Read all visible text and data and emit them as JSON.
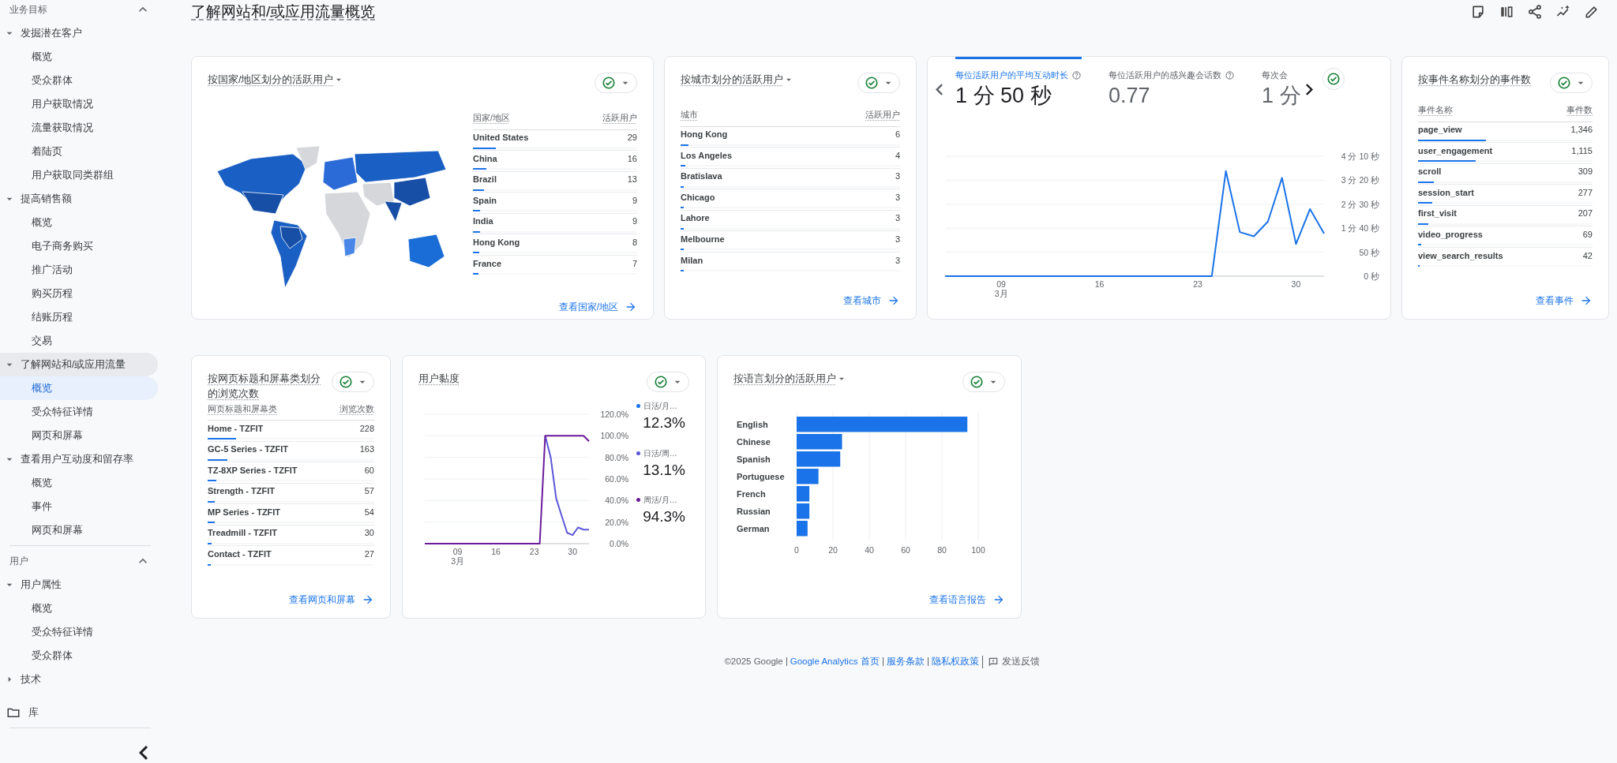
{
  "sidebar": {
    "sections": [
      {
        "label": "业务目标",
        "expanded": true,
        "groups": [
          {
            "label": "发掘潜在客户",
            "expanded": true,
            "selected": false,
            "children": [
              {
                "label": "概览",
                "selected": false
              },
              {
                "label": "受众群体",
                "selected": false
              },
              {
                "label": "用户获取情况",
                "selected": false
              },
              {
                "label": "流量获取情况",
                "selected": false
              },
              {
                "label": "着陆页",
                "selected": false
              },
              {
                "label": "用户获取同类群组",
                "selected": false
              }
            ]
          },
          {
            "label": "提高销售额",
            "expanded": true,
            "selected": false,
            "children": [
              {
                "label": "概览",
                "selected": false
              },
              {
                "label": "电子商务购买",
                "selected": false
              },
              {
                "label": "推广活动",
                "selected": false
              },
              {
                "label": "购买历程",
                "selected": false
              },
              {
                "label": "结账历程",
                "selected": false
              },
              {
                "label": "交易",
                "selected": false
              }
            ]
          },
          {
            "label": "了解网站和/或应用流量",
            "expanded": true,
            "selected": true,
            "children": [
              {
                "label": "概览",
                "selected": true
              },
              {
                "label": "受众特征详情",
                "selected": false
              },
              {
                "label": "网页和屏幕",
                "selected": false
              }
            ]
          },
          {
            "label": "查看用户互动度和留存率",
            "expanded": true,
            "selected": false,
            "children": [
              {
                "label": "概览",
                "selected": false
              },
              {
                "label": "事件",
                "selected": false
              },
              {
                "label": "网页和屏幕",
                "selected": false
              }
            ]
          }
        ]
      },
      {
        "label": "用户",
        "expanded": true,
        "groups": [
          {
            "label": "用户属性",
            "expanded": true,
            "selected": false,
            "children": [
              {
                "label": "概览",
                "selected": false
              },
              {
                "label": "受众特征详情",
                "selected": false
              },
              {
                "label": "受众群体",
                "selected": false
              }
            ]
          },
          {
            "label": "技术",
            "expanded": false,
            "selected": false
          }
        ]
      }
    ],
    "library": "库"
  },
  "page_title": "了解网站和/或应用流量概览",
  "country_card": {
    "title": "按国家/地区划分的活跃用户",
    "has_dropdown": true,
    "columns": [
      "国家/地区",
      "活跃用户"
    ],
    "rows": [
      {
        "label": "United States",
        "value": "29",
        "level": 0.14
      },
      {
        "label": "China",
        "value": "16",
        "level": 0.08
      },
      {
        "label": "Brazil",
        "value": "13",
        "level": 0.065
      },
      {
        "label": "Spain",
        "value": "9",
        "level": 0.045
      },
      {
        "label": "India",
        "value": "9",
        "level": 0.045
      },
      {
        "label": "Hong Kong",
        "value": "8",
        "level": 0.04
      },
      {
        "label": "France",
        "value": "7",
        "level": 0.035
      }
    ],
    "link": "查看国家/地区"
  },
  "city_card": {
    "title": "按城市划分的活跃用户",
    "has_dropdown": true,
    "columns": [
      "城市",
      "活跃用户"
    ],
    "rows": [
      {
        "label": "Hong Kong",
        "value": "6",
        "level": 0.036
      },
      {
        "label": "Los Angeles",
        "value": "4",
        "level": 0.022
      },
      {
        "label": "Bratislava",
        "value": "3",
        "level": 0.016
      },
      {
        "label": "Chicago",
        "value": "3",
        "level": 0.016
      },
      {
        "label": "Lahore",
        "value": "3",
        "level": 0.016
      },
      {
        "label": "Melbourne",
        "value": "3",
        "level": 0.016
      },
      {
        "label": "Milan",
        "value": "3",
        "level": 0.016
      }
    ],
    "link": "查看城市"
  },
  "engagement_card": {
    "tabs": [
      {
        "label": "每位活跃用户的平均互动时长",
        "value": "1 分 50 秒",
        "selected": true,
        "help_icon": true
      },
      {
        "label": "每位活跃用户的感兴趣会话数",
        "value": "0.77",
        "selected": false,
        "help_icon": true
      },
      {
        "label": "每次会",
        "value": "1 分",
        "selected": false,
        "help_icon": false
      }
    ],
    "month_label": "3月",
    "chart_data": {
      "type": "line",
      "x": [
        5,
        6,
        7,
        8,
        9,
        10,
        11,
        12,
        13,
        14,
        15,
        16,
        17,
        18,
        19,
        20,
        21,
        22,
        23,
        24,
        25,
        26,
        27,
        28,
        29,
        30,
        31,
        32
      ],
      "series": [
        {
          "color": "#1a73e8",
          "values": [
            0,
            0,
            0,
            0,
            0,
            0,
            0,
            0,
            0,
            0,
            0,
            0,
            0,
            0,
            0,
            0,
            0,
            0,
            0,
            0,
            219,
            92,
            83,
            114,
            205,
            67,
            140,
            89
          ]
        }
      ],
      "grid": true,
      "xlim": [
        5,
        32
      ],
      "ylim": [
        0,
        250
      ],
      "xticks": [
        {
          "value": 9,
          "label": "09"
        },
        {
          "value": 16,
          "label": "16"
        },
        {
          "value": 23,
          "label": "23"
        },
        {
          "value": 30,
          "label": "30"
        }
      ],
      "yticks": [
        {
          "value": 0,
          "label": "0 秒"
        },
        {
          "value": 50,
          "label": "50 秒"
        },
        {
          "value": 100,
          "label": "1 分 40 秒"
        },
        {
          "value": 150,
          "label": "2 分 30 秒"
        },
        {
          "value": 200,
          "label": "3 分 20 秒"
        },
        {
          "value": 250,
          "label": "4 分 10 秒"
        }
      ]
    }
  },
  "events_card": {
    "title": "按事件名称划分的事件数",
    "has_dropdown": false,
    "columns": [
      "事件名称",
      "事件数"
    ],
    "rows": [
      {
        "label": "page_view",
        "value": "1,346",
        "level": 0.39
      },
      {
        "label": "user_engagement",
        "value": "1,115",
        "level": 0.33
      },
      {
        "label": "scroll",
        "value": "309",
        "level": 0.09
      },
      {
        "label": "session_start",
        "value": "277",
        "level": 0.08
      },
      {
        "label": "first_visit",
        "value": "207",
        "level": 0.06
      },
      {
        "label": "video_progress",
        "value": "69",
        "level": 0.02
      },
      {
        "label": "view_search_results",
        "value": "42",
        "level": 0.01
      }
    ],
    "link": "查看事件"
  },
  "pages_card": {
    "title": "按网页标题和屏幕类划分的浏览次数",
    "has_dropdown": false,
    "columns": [
      "网页标题和屏幕类",
      "浏览次数"
    ],
    "rows": [
      {
        "label": "Home - TZFIT",
        "value": "228",
        "level": 0.17
      },
      {
        "label": "GC-5 Series - TZFIT",
        "value": "163",
        "level": 0.12
      },
      {
        "label": "TZ-8XP Series - TZFIT",
        "value": "60",
        "level": 0.05
      },
      {
        "label": "Strength - TZFIT",
        "value": "57",
        "level": 0.045
      },
      {
        "label": "MP Series - TZFIT",
        "value": "54",
        "level": 0.045
      },
      {
        "label": "Treadmill - TZFIT",
        "value": "30",
        "level": 0.025
      },
      {
        "label": "Contact - TZFIT",
        "value": "27",
        "level": 0.02
      }
    ],
    "link": "查看网页和屏幕"
  },
  "stickiness_card": {
    "title": "用户黏度",
    "has_dropdown": false,
    "month_label": "3月",
    "legend": [
      {
        "label": "日活/月…",
        "value": "12.3%",
        "color": "#1a73e8"
      },
      {
        "label": "日活/周…",
        "value": "13.1%",
        "color": "#5b57d9"
      },
      {
        "label": "周活/月…",
        "value": "94.3%",
        "color": "#6a1b9a"
      }
    ],
    "chart_data": {
      "type": "line",
      "x": [
        3,
        4,
        5,
        6,
        7,
        8,
        9,
        10,
        11,
        12,
        13,
        14,
        15,
        16,
        17,
        18,
        19,
        20,
        21,
        22,
        23,
        24,
        25,
        26,
        27,
        28,
        29,
        30,
        31,
        32,
        33
      ],
      "series": [
        {
          "color": "#5b57d9",
          "values": [
            null,
            null,
            null,
            null,
            null,
            null,
            null,
            null,
            null,
            null,
            null,
            null,
            null,
            null,
            null,
            null,
            null,
            null,
            null,
            null,
            null,
            null,
            100,
            80,
            42,
            26,
            10,
            8,
            15,
            13,
            13
          ]
        },
        {
          "color": "#6a1b9a",
          "values": [
            0,
            0,
            0,
            0,
            0,
            0,
            0,
            0,
            0,
            0,
            0,
            0,
            0,
            0,
            0,
            0,
            0,
            0,
            0,
            0,
            0,
            0,
            100,
            100,
            100,
            100,
            100,
            100,
            100,
            100,
            95
          ]
        }
      ],
      "grid": true,
      "xlim": [
        3,
        33
      ],
      "ylim": [
        0,
        120
      ],
      "xticks": [
        {
          "value": 9,
          "label": "09"
        },
        {
          "value": 16,
          "label": "16"
        },
        {
          "value": 23,
          "label": "23"
        },
        {
          "value": 30,
          "label": "30"
        }
      ],
      "yticks": [
        {
          "value": 0,
          "label": "0.0%"
        },
        {
          "value": 20,
          "label": "20.0%"
        },
        {
          "value": 40,
          "label": "40.0%"
        },
        {
          "value": 60,
          "label": "60.0%"
        },
        {
          "value": 80,
          "label": "80.0%"
        },
        {
          "value": 100,
          "label": "100.0%"
        },
        {
          "value": 120,
          "label": "120.0%"
        }
      ]
    }
  },
  "language_card": {
    "title": "按语言划分的活跃用户",
    "has_dropdown": true,
    "chart_data": {
      "type": "bar",
      "orientation": "horizontal",
      "categories": [
        "English",
        "Chinese",
        "Spanish",
        "Portuguese",
        "French",
        "Russian",
        "German"
      ],
      "series": [
        {
          "color": "#1a73e8",
          "values": [
            94,
            25,
            24,
            12,
            7,
            7,
            6
          ]
        }
      ],
      "grid": true,
      "xlim": [
        0,
        100
      ],
      "xticks": [
        0,
        20,
        40,
        60,
        80,
        100
      ]
    },
    "link": "查看语言报告"
  },
  "footer": {
    "copyright": "©2025 Google",
    "links": [
      "Google Analytics 首页",
      "服务条款",
      "隐私权政策"
    ],
    "feedback": "发送反馈"
  }
}
